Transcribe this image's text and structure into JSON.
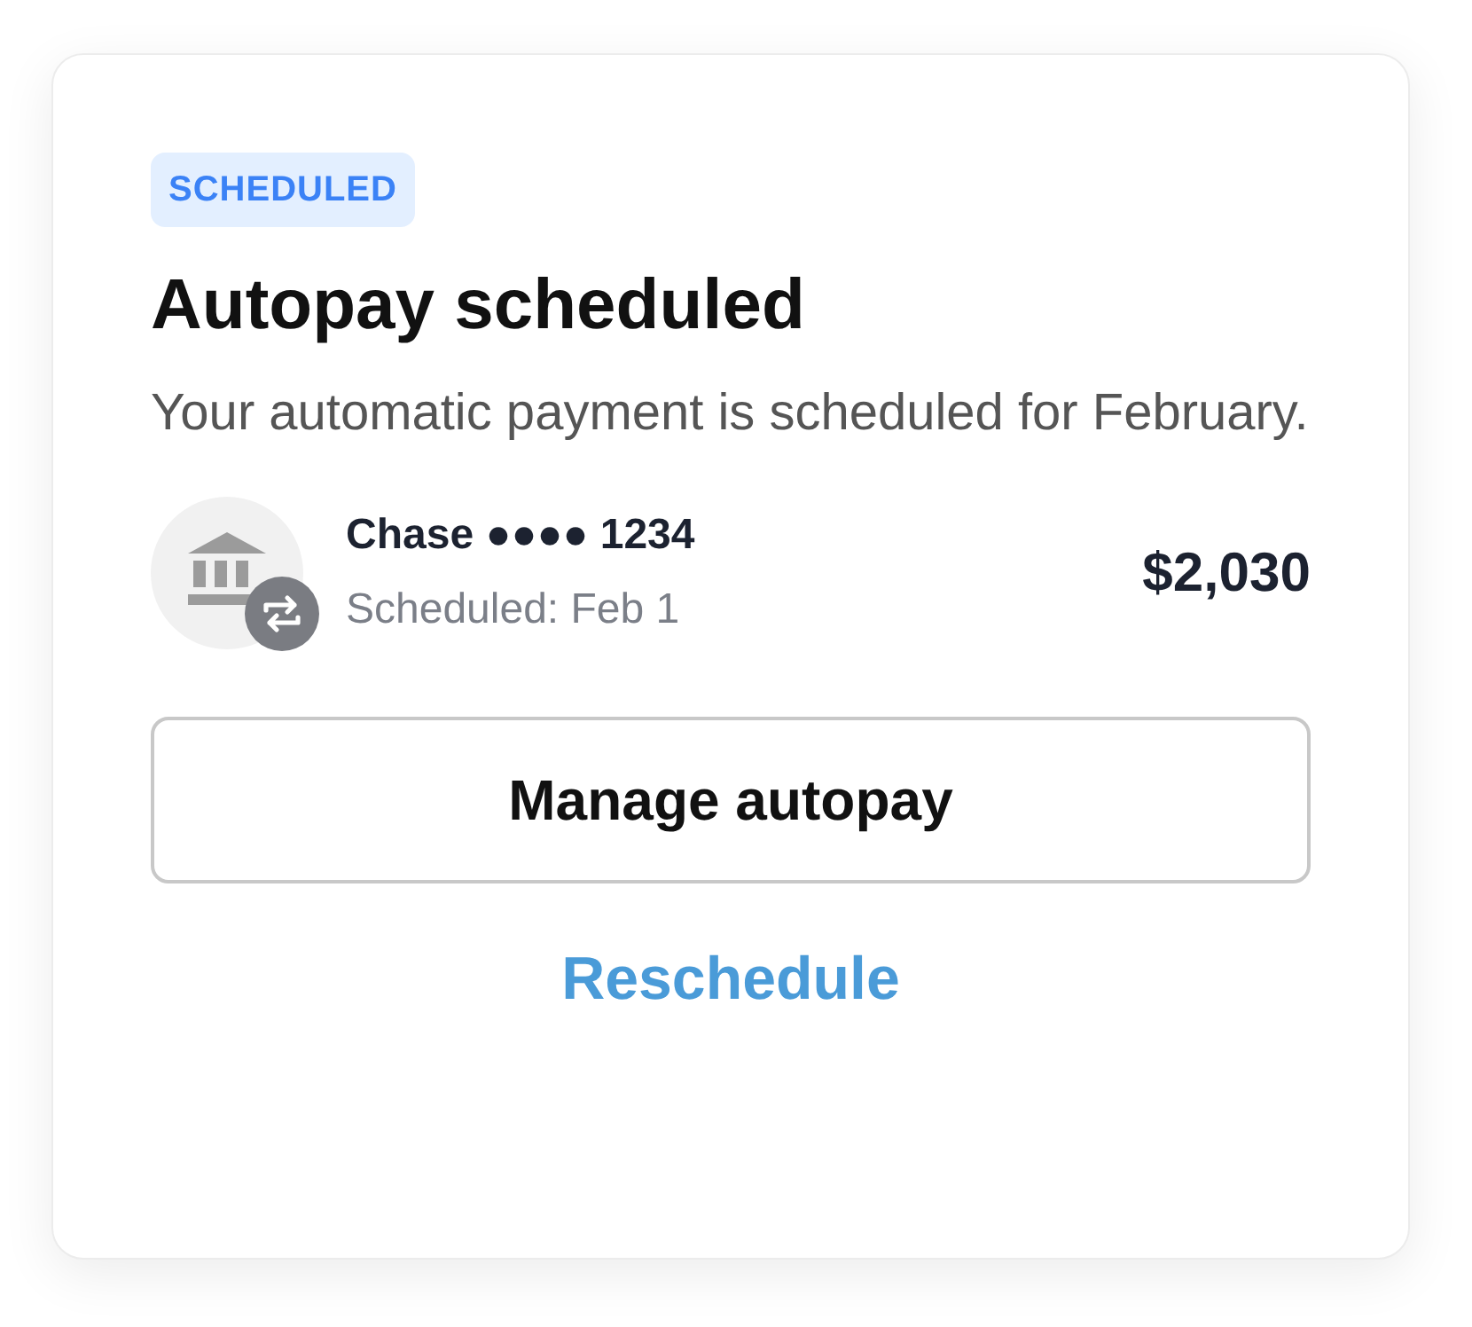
{
  "status_badge": "SCHEDULED",
  "title": "Autopay scheduled",
  "description": "Your automatic payment is scheduled for February.",
  "payment": {
    "account": "Chase ●●●● 1234",
    "schedule": "Scheduled: Feb 1",
    "amount": "$2,030"
  },
  "buttons": [
    {
      "kind": "outline",
      "label": "Manage autopay"
    },
    {
      "kind": "link",
      "label": "Reschedule"
    }
  ]
}
